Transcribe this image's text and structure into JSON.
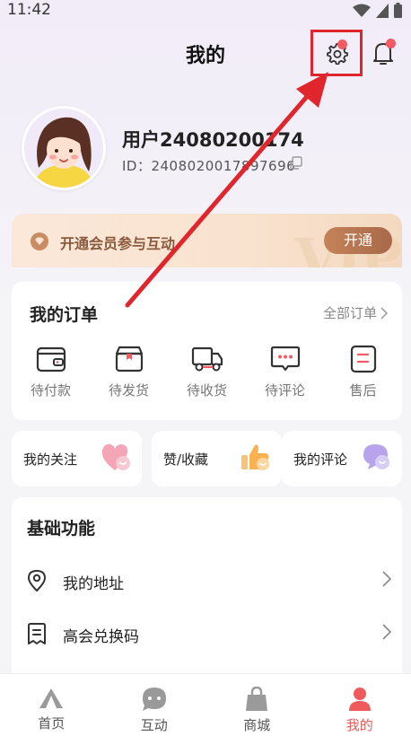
{
  "status_bar": {
    "time": "11:42"
  },
  "header": {
    "title": "我的"
  },
  "user": {
    "name": "用户24080200174",
    "id": "ID：2408020017897696"
  },
  "vip": {
    "text": "开通会员参与互动",
    "button": "开通",
    "watermark": "VIP"
  },
  "orders": {
    "title": "我的订单",
    "all_label": "全部订单",
    "items": [
      {
        "label": "待付款",
        "icon": "wallet-icon"
      },
      {
        "label": "待发货",
        "icon": "box-icon"
      },
      {
        "label": "待收货",
        "icon": "truck-icon"
      },
      {
        "label": "待评论",
        "icon": "comment-icon"
      },
      {
        "label": "售后",
        "icon": "after-sale-icon"
      }
    ]
  },
  "quick": {
    "follow": "我的关注",
    "likes": "赞/收藏",
    "comments": "我的评论"
  },
  "basic": {
    "title": "基础功能",
    "rows": [
      {
        "label": "我的地址",
        "icon": "location-icon"
      },
      {
        "label": "高会兑换码",
        "icon": "receipt-icon"
      }
    ]
  },
  "tabs": [
    {
      "label": "首页",
      "icon": "home-icon"
    },
    {
      "label": "互动",
      "icon": "chat-icon"
    },
    {
      "label": "商城",
      "icon": "bag-icon"
    },
    {
      "label": "我的",
      "icon": "person-icon",
      "active": true
    }
  ],
  "colors": {
    "accent": "#ef5b5b",
    "highlight_box": "#e0262c",
    "vip_button": "#b47552"
  }
}
